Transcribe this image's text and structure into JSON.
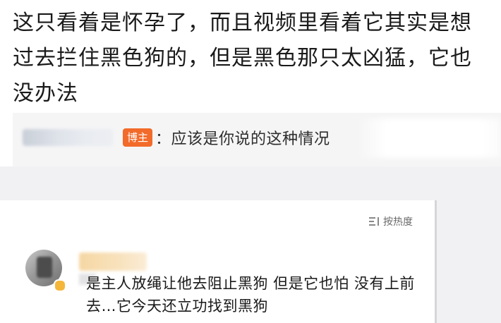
{
  "top_comment": {
    "text": "这只看着是怀孕了，而且视频里看着它其实是想过去拦住黑色狗的，但是黑色那只太凶猛，它也没办法",
    "reply": {
      "badge": "博主",
      "text": "：应该是你说的这种情况"
    }
  },
  "comments_section": {
    "sort_label": "按热度",
    "sort_icon": "sort-lines-icon",
    "comment": {
      "text": "是主人放绳让他去阻止黑狗 但是它也怕 没有上前去…它今天还立功找到黑狗"
    }
  },
  "colors": {
    "badge_bg": "#f26b2a",
    "vip_dot": "#f4b73a",
    "page_bg": "#f1f1f3"
  }
}
